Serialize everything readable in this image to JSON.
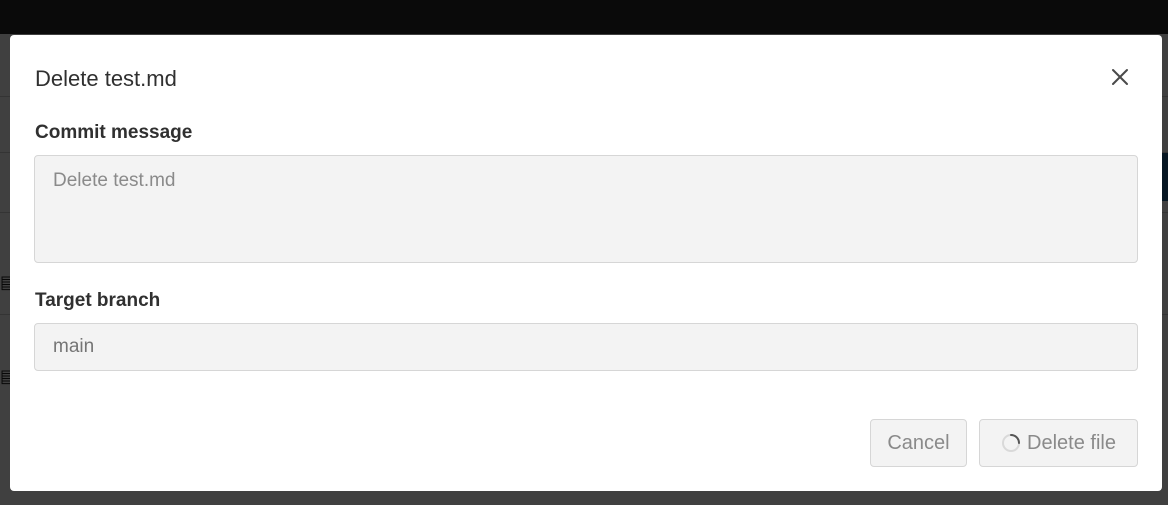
{
  "modal": {
    "title": "Delete test.md",
    "close_icon": "close-icon",
    "commit_label": "Commit message",
    "commit_value": "",
    "commit_placeholder": "Delete test.md",
    "branch_label": "Target branch",
    "branch_value": "",
    "branch_placeholder": "main",
    "cancel_label": "Cancel",
    "delete_label": "Delete file",
    "loading_icon": "spinner-icon"
  },
  "colors": {
    "overlay": "#000000",
    "modal_bg": "#ffffff",
    "input_bg": "#f3f3f3",
    "text": "#303030",
    "muted_text": "#8a8a8a"
  }
}
